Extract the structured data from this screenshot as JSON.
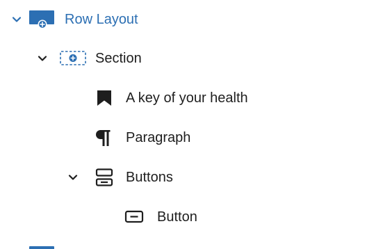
{
  "list_view": {
    "items": [
      {
        "label": "Row Layout",
        "icon": "row-layout-icon",
        "expanded": true,
        "selected": true
      },
      {
        "label": "Section",
        "icon": "section-icon",
        "expanded": true
      },
      {
        "label": "A key of your health",
        "icon": "bookmark-icon"
      },
      {
        "label": "Paragraph",
        "icon": "paragraph-icon"
      },
      {
        "label": "Buttons",
        "icon": "buttons-icon",
        "expanded": true
      },
      {
        "label": "Button",
        "icon": "button-icon"
      }
    ]
  },
  "colors": {
    "accent": "#2c6fb3",
    "text": "#1e1e1e"
  }
}
